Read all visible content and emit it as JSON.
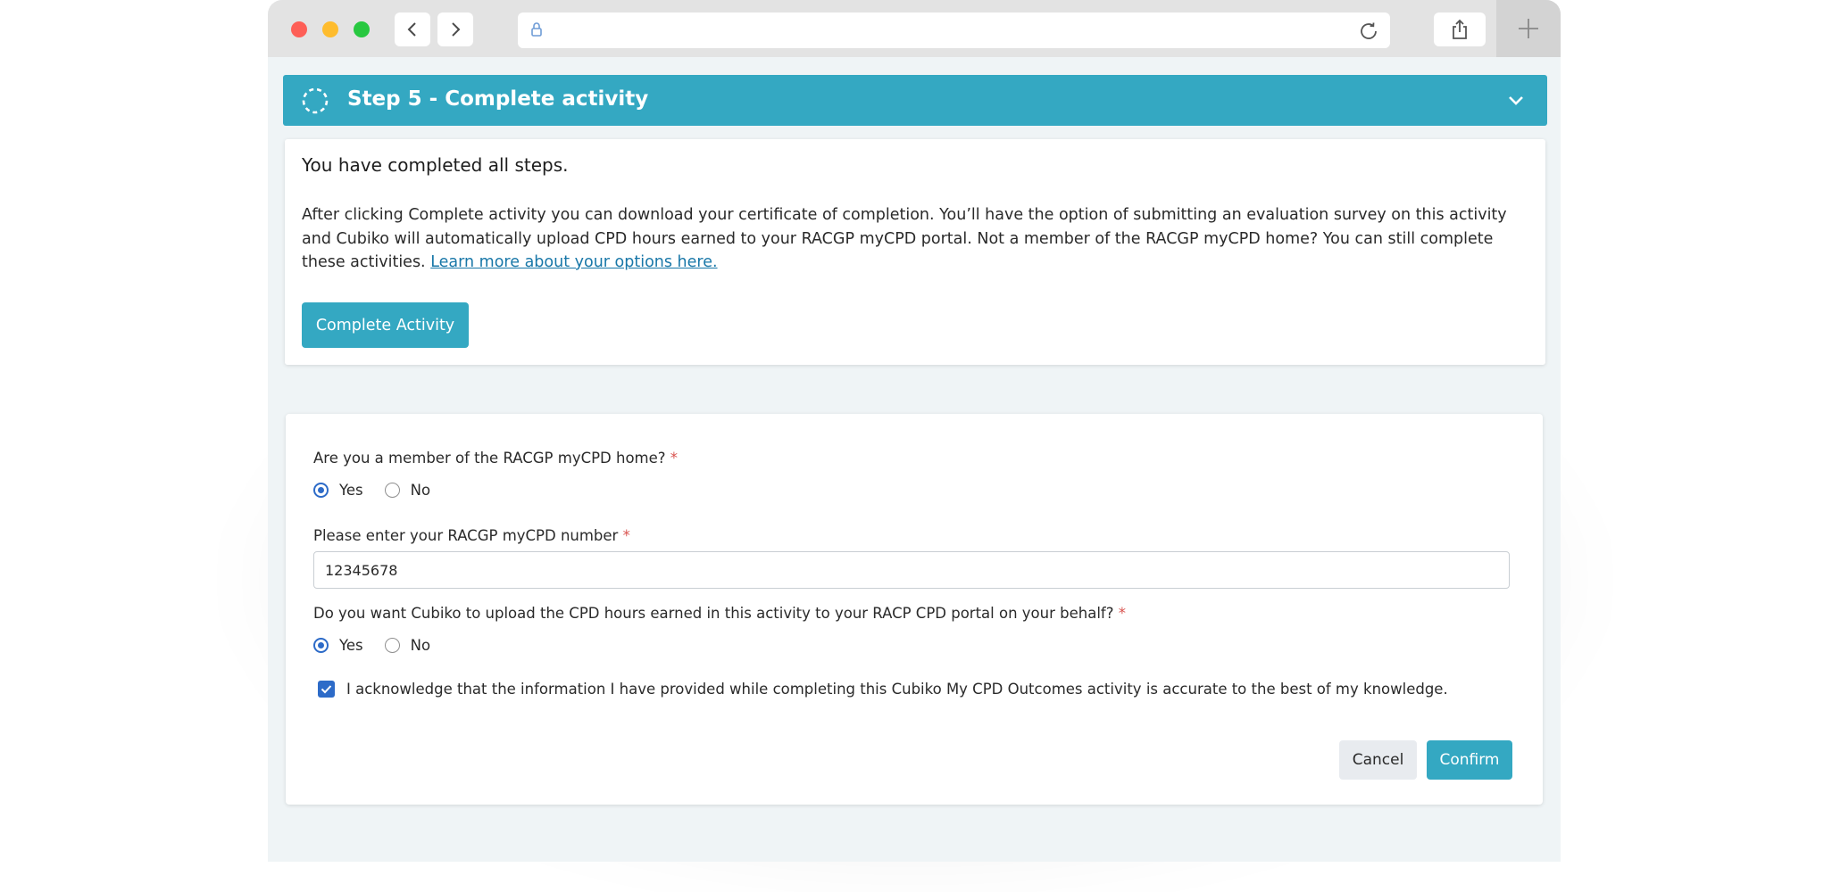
{
  "browser": {
    "url": "",
    "icons": [
      "close-window",
      "minimize-window",
      "zoom-window",
      "chevron-left-icon",
      "chevron-right-icon",
      "lock-icon",
      "reload-icon",
      "share-icon",
      "plus-icon"
    ]
  },
  "step": {
    "title": "Step 5 - Complete activity"
  },
  "completion": {
    "heading": "You have completed all steps.",
    "body": "After clicking Complete activity you can download your certificate of completion. You’ll have the option of submitting an evaluation survey on this activity and Cubiko will automatically upload CPD hours earned to your RACGP myCPD portal. Not a member of the RACGP myCPD home? You can still complete these activities.",
    "link": "Learn more about your options here.",
    "button": "Complete Activity"
  },
  "form": {
    "q1": {
      "label": "Are you a member of the RACGP myCPD home?",
      "required": "*",
      "options": [
        "Yes",
        "No"
      ],
      "selected": "Yes"
    },
    "q2": {
      "label": "Please enter your RACGP myCPD number",
      "required": "*",
      "value": "12345678"
    },
    "q3": {
      "label": "Do you want Cubiko to upload the CPD hours earned in this activity to your RACP CPD portal on your behalf?",
      "required": "*",
      "options": [
        "Yes",
        "No"
      ],
      "selected": "Yes"
    },
    "acknowledge": {
      "text": "I acknowledge that the information I have provided while completing this Cubiko My CPD Outcomes activity is accurate to the best of my knowledge.",
      "checked": true
    },
    "cancel": "Cancel",
    "confirm": "Confirm"
  },
  "colors": {
    "accent": "#34a8c2",
    "radio": "#2d6bc8",
    "link": "#1877a8",
    "required": "#d9534f"
  }
}
